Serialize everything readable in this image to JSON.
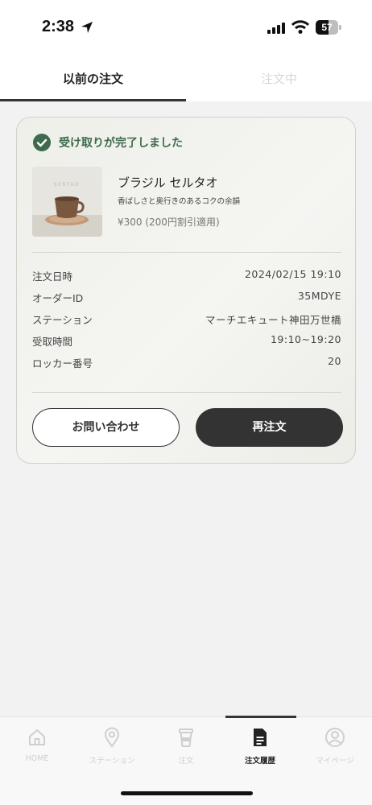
{
  "status_bar": {
    "time": "2:38",
    "battery": "57",
    "battery_level": 0.57
  },
  "tabs": [
    {
      "label": "以前の注文",
      "active": true
    },
    {
      "label": "注文中",
      "active": false
    }
  ],
  "order": {
    "status": "受け取りが完了しました",
    "product": {
      "image_text": "SERTAO",
      "name": "ブラジル セルタオ",
      "description": "香ばしさと奥行きのあるコクの余韻",
      "price": "¥300 (200円割引適用)"
    },
    "details": [
      {
        "label": "注文日時",
        "value": "2024/02/15 19:10"
      },
      {
        "label": "オーダーID",
        "value": "35MDYE"
      },
      {
        "label": "ステーション",
        "value": "マーチエキュート神田万世橋"
      },
      {
        "label": "受取時間",
        "value": "19:10~19:20"
      },
      {
        "label": "ロッカー番号",
        "value": "20"
      }
    ],
    "buttons": {
      "inquiry": "お問い合わせ",
      "reorder": "再注文"
    }
  },
  "colors": {
    "success_green": "#3d6b4b",
    "dark": "#333333",
    "inactive": "#cfcfcf"
  },
  "bottom_nav": [
    {
      "label": "HOME",
      "icon": "home-icon",
      "active": false
    },
    {
      "label": "ステーション",
      "icon": "map-pin-icon",
      "active": false
    },
    {
      "label": "注文",
      "icon": "coffee-cup-icon",
      "active": false
    },
    {
      "label": "注文履歴",
      "icon": "document-icon",
      "active": true
    },
    {
      "label": "マイページ",
      "icon": "user-icon",
      "active": false
    }
  ]
}
